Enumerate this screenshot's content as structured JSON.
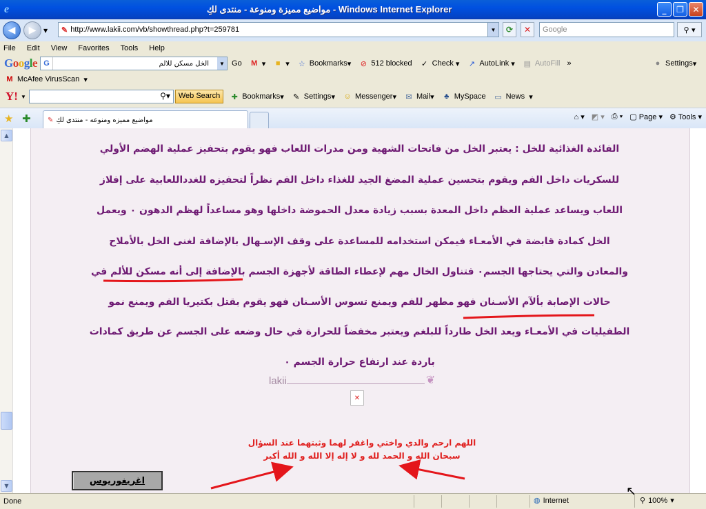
{
  "window": {
    "title": "مواضيع مميزة ومنوعة - منتدى لكِ - Windows Internet Explorer",
    "minimize": "_",
    "restore": "❐",
    "close": "✕"
  },
  "address": {
    "url": "http://www.lakii.com/vb/showthread.php?t=259781",
    "search_placeholder": "Google"
  },
  "menu": [
    "File",
    "Edit",
    "View",
    "Favorites",
    "Tools",
    "Help"
  ],
  "google_toolbar": {
    "search_value": "الخل مسكن للالم",
    "go": "Go",
    "bookmarks": "Bookmarks",
    "blocked": "512 blocked",
    "check": "Check",
    "autolink": "AutoLink",
    "autofill": "AutoFill",
    "more": "»",
    "settings": "Settings"
  },
  "mcafee": {
    "label": "McAfee VirusScan"
  },
  "yahoo_toolbar": {
    "logo": "Y!",
    "web_search": "Web Search",
    "bookmarks": "Bookmarks",
    "settings": "Settings",
    "messenger": "Messenger",
    "mail": "Mail",
    "myspace": "MySpace",
    "news": "News"
  },
  "tab": {
    "title": "مواضيع مميزه ومنوعه - منتدى لكِ"
  },
  "command_bar": {
    "page": "Page",
    "tools": "Tools"
  },
  "post": {
    "lines": [
      "الفائدة الغذائية للخل : يعتبر الخل من فاتحات الشهية ومن مدرات اللعاب فهو يقوم بتحفيز عملية الهضم الأولي",
      "للسكريات داخل الفم ويقوم بتحسين عملية المضغ الجيد للغذاء داخل الفم نظراً لتحفيزه للغدداللعابية على إفلاز",
      "اللعاب ويساعد عملية العظم داخل المعدة بسبب زيادة معدل الحموضة داخلها وهو مساعداً لهظم الدهون ٠ ويعمل",
      "الخل كمادة قابضة في الأمعـاء فيمكن استخدامه للمساعدة على وقف الإسـهال بالإضافة لغنى الخل بالأملاح",
      "والمعادن والتي يحتاجها الجسم٠ فتناول الخال مهم لإعطاء الطاقة لأجهزة الجسم بالإضافة إلى أنه مسكن للألم في",
      "حالات الإصابة بألآم الأسـنان فهو مطهر للفم ويمنع تسوس الأسـنان فهو يقوم بقتل بكتيريا الفم ويمنع نمو",
      "الطفيليات في الأمعـاء ويعد الخل طارداً للبلغم ويعتبر مخفضاً للحرارة في حال وضعه على الجسم عن طريق كمادات",
      "باردة عند ارتفاع حرارة الجسم ٠"
    ],
    "logo": "lakii",
    "prayer_line1": "اللهم ارحم والدي واختي واغفر لهما وثبتهما عند السؤال",
    "prayer_line2": "سبحان الله و الحمد لله و لا إله إلا الله و الله أكبر",
    "signature": "اغريغوريوس"
  },
  "status": {
    "text": "Done",
    "zone": "Internet",
    "zoom": "100%"
  }
}
